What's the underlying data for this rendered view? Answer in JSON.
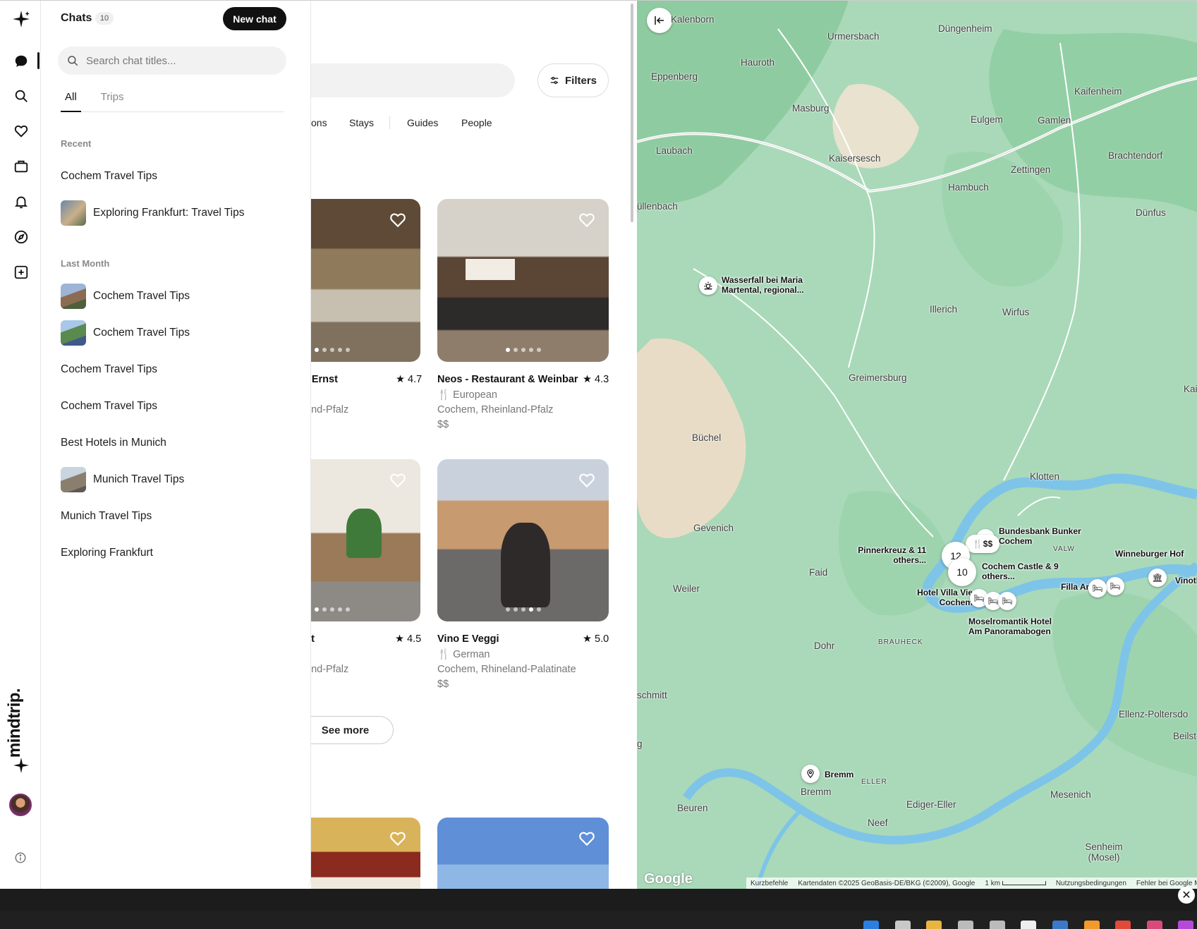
{
  "sidebar": {
    "title": "Chats",
    "count": "10",
    "new_chat_label": "New chat",
    "search_placeholder": "Search chat titles...",
    "tabs": [
      "All",
      "Trips"
    ],
    "active_tab": "All",
    "groups": [
      {
        "label": "Recent",
        "items": [
          {
            "title": "Cochem Travel Tips",
            "thumb": false
          },
          {
            "title": "Exploring Frankfurt: Travel Tips",
            "thumb": true
          }
        ]
      },
      {
        "label": "Last Month",
        "items": [
          {
            "title": "Cochem Travel Tips",
            "thumb": true
          },
          {
            "title": "Cochem Travel Tips",
            "thumb": true
          },
          {
            "title": "Cochem Travel Tips",
            "thumb": false
          },
          {
            "title": "Cochem Travel Tips",
            "thumb": false
          },
          {
            "title": "Best Hotels in Munich",
            "thumb": false
          },
          {
            "title": "Munich Travel Tips",
            "thumb": true
          },
          {
            "title": "Munich Travel Tips",
            "thumb": false
          },
          {
            "title": "Exploring Frankfurt",
            "thumb": false
          }
        ]
      }
    ]
  },
  "rail": {
    "brand": "mindtrip.",
    "icons": [
      "sparkle-icon",
      "chat-icon",
      "search-icon",
      "heart-icon",
      "suitcase-icon",
      "bell-icon",
      "compass-icon",
      "add-icon"
    ]
  },
  "content": {
    "filters_label": "Filters",
    "categories": [
      "ons",
      "Stays",
      "Guides",
      "People"
    ],
    "cards": [
      {
        "name": "- Ernst",
        "rating": "4.7",
        "cuisine": "",
        "location": "and-Pfalz",
        "price": ""
      },
      {
        "name": "Neos - Restaurant & Weinbar",
        "rating": "4.3",
        "cuisine": "European",
        "location": "Cochem, Rheinland-Pfalz",
        "price": "$$"
      },
      {
        "name": "st",
        "rating": "4.5",
        "cuisine": "",
        "location": "and-Pfalz",
        "price": ""
      },
      {
        "name": "Vino E Veggi",
        "rating": "5.0",
        "cuisine": "German",
        "location": "Cochem, Rhineland-Palatinate",
        "price": "$$"
      }
    ],
    "see_more_label": "See more"
  },
  "map": {
    "places": [
      "Kalenborn",
      "Urmersbach",
      "Düngenheim",
      "Hauroth",
      "Eppenberg",
      "Kaifenheim",
      "Masburg",
      "Eulgem",
      "Gamlen",
      "Laubach",
      "Kaisersesch",
      "Brachtendorf",
      "Zettingen",
      "Hambuch",
      "üllenbach",
      "Dünfus",
      "Illerich",
      "Wirfus",
      "Greimersburg",
      "Kai",
      "Büchel",
      "Klotten",
      "Gevenich",
      "Faid",
      "Weiler",
      "Dohr",
      "BRAUHECK",
      "Ellenz-Poltersdo",
      "schmitt",
      "Beilstei",
      "g",
      "ELLER",
      "Bremm",
      "Ediger-Eller",
      "Mesenich",
      "Beuren",
      "Neef",
      "Senheim (Mosel)"
    ],
    "pois": {
      "waterfall": "Wasserfall bei Maria Martental, regional...",
      "bunker": "Bundesbank Bunker Cochem",
      "pinnerkreuz": "Pinnerkreuz & 11 others...",
      "castle": "Cochem Castle & 9 others...",
      "winneburger": "Winneburger Hof",
      "vinoth": "Vinoth",
      "filla": "Filla Andre",
      "villa_vie": "Hotel Villa Vie Cochem",
      "moselromantik": "Moselromantik Hotel Am Panoramabogen",
      "bremm_pin": "Bremm",
      "price_tag": "$$",
      "valw": "VALW"
    },
    "clusters": [
      "12",
      "10"
    ],
    "footer": [
      "Kurzbefehle",
      "Kartendaten ©2025 GeoBasis-DE/BKG (©2009), Google",
      "1 km",
      "Nutzungsbedingungen",
      "Fehler bei Google Ma"
    ],
    "google": "Google"
  },
  "colors": {
    "accent": "#111111",
    "map_green": "#a8d8b9",
    "river": "#7ec4e8"
  }
}
